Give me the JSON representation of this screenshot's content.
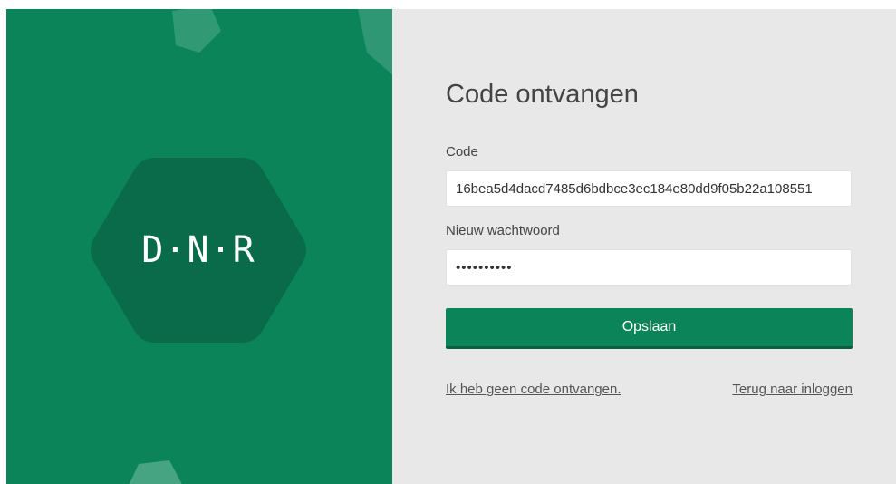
{
  "brand": {
    "logo_text": "D·N·R",
    "panel_color": "#0b845a",
    "hex_color": "#0a6b4a"
  },
  "form": {
    "title": "Code ontvangen",
    "code_label": "Code",
    "code_value": "16bea5d4dacd7485d6bdbce3ec184e80dd9f05b22a108551",
    "password_label": "Nieuw wachtwoord",
    "password_value": "••••••••••",
    "save_label": "Opslaan",
    "no_code_link": "Ik heb geen code ontvangen.",
    "back_link": "Terug naar inloggen",
    "accent_color": "#0b845a"
  }
}
